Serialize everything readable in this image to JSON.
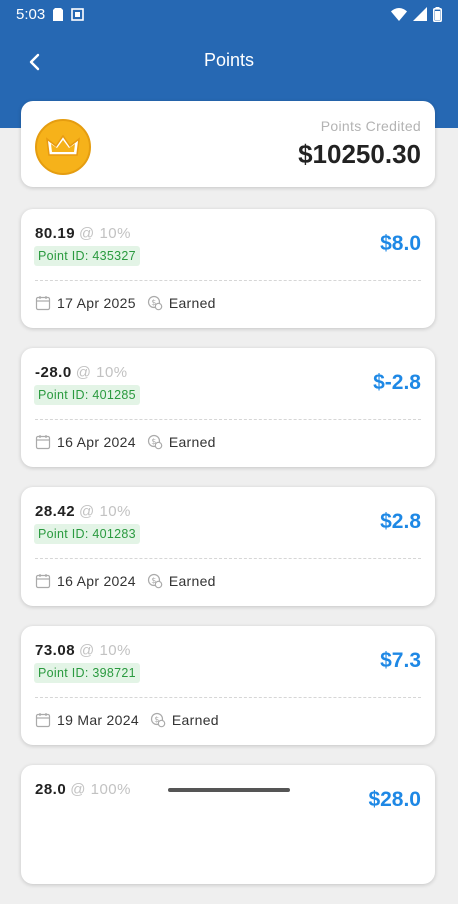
{
  "status": {
    "time": "5:03"
  },
  "header": {
    "title": "Points"
  },
  "summary": {
    "label": "Points Credited",
    "total": "$10250.30"
  },
  "entries": [
    {
      "points": "80.19",
      "rate": "@ 10%",
      "point_id": "Point ID: 435327",
      "amount": "$8.0",
      "date": "17 Apr 2025",
      "status": "Earned"
    },
    {
      "points": "-28.0",
      "rate": "@ 10%",
      "point_id": "Point ID: 401285",
      "amount": "$-2.8",
      "date": "16 Apr 2024",
      "status": "Earned"
    },
    {
      "points": "28.42",
      "rate": "@ 10%",
      "point_id": "Point ID: 401283",
      "amount": "$2.8",
      "date": "16 Apr 2024",
      "status": "Earned"
    },
    {
      "points": "73.08",
      "rate": "@ 10%",
      "point_id": "Point ID: 398721",
      "amount": "$7.3",
      "date": "19 Mar 2024",
      "status": "Earned"
    },
    {
      "points": "28.0",
      "rate": "@ 100%",
      "point_id": "",
      "amount": "$28.0",
      "date": "",
      "status": ""
    }
  ],
  "colors": {
    "primary": "#2668b3",
    "amount": "#1e88e5",
    "id_badge_bg": "#e3f4e6",
    "id_badge_text": "#2a9a3f",
    "crown_badge": "#f6b21a"
  },
  "icons": {
    "back": "chevron-left-icon",
    "calendar": "calendar-icon",
    "coin": "coin-icon",
    "crown": "crown-icon"
  }
}
